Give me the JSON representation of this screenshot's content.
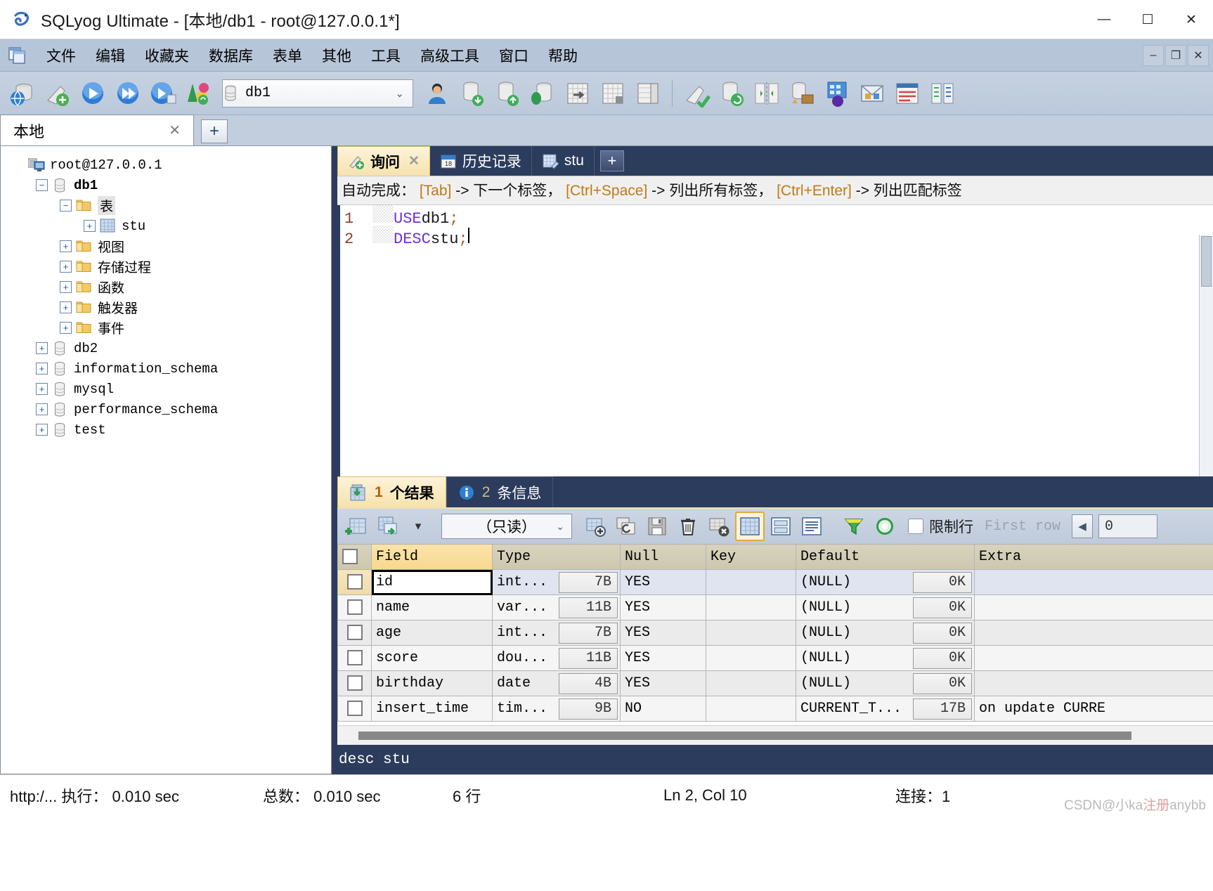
{
  "window": {
    "title": "SQLyog Ultimate - [本地/db1 - root@127.0.0.1*]",
    "minimize": "—",
    "maximize": "☐",
    "close": "✕"
  },
  "menubar": {
    "items": [
      {
        "label": "文件"
      },
      {
        "label": "编辑"
      },
      {
        "label": "收藏夹"
      },
      {
        "label": "数据库"
      },
      {
        "label": "表单"
      },
      {
        "label": "其他"
      },
      {
        "label": "工具"
      },
      {
        "label": "高级工具"
      },
      {
        "label": "窗口"
      },
      {
        "label": "帮助"
      }
    ],
    "mdi": {
      "minimize": "–",
      "restore": "❐",
      "close": "✕"
    }
  },
  "toolbar": {
    "db_selector_value": "db1",
    "db_selector_caret": "⌄",
    "icons": [
      "new-connection-icon",
      "new-query-icon",
      "execute-query-icon",
      "execute-all-icon",
      "execute-current-icon",
      "schema-sync-icon"
    ],
    "icons_right": [
      "user-manager-icon",
      "import-db-icon",
      "export-db-icon",
      "backup-db-icon",
      "export-grid-icon",
      "table-data-icon",
      "table-diagnostics-icon",
      "query-builder-icon",
      "sync-db-icon",
      "schema-compare-icon",
      "data-transfer-icon",
      "scheduled-backup-icon",
      "notification-services-icon",
      "form-view-icon",
      "sql-formatter-icon"
    ]
  },
  "connection_tabs": {
    "items": [
      {
        "label": "本地",
        "close": "✕"
      }
    ],
    "add_label": "+"
  },
  "tree": {
    "nodes": [
      {
        "expander": "",
        "icon": "host-icon",
        "label": "root@127.0.0.1",
        "indent": 0,
        "bold": false,
        "selected": "none"
      },
      {
        "expander": "−",
        "icon": "database-icon",
        "label": "db1",
        "indent": 1,
        "bold": true,
        "selected": "none"
      },
      {
        "expander": "−",
        "icon": "folder-icon",
        "label": "表",
        "indent": 2,
        "bold": false,
        "selected": "gray"
      },
      {
        "expander": "+",
        "icon": "table-icon",
        "label": "stu",
        "indent": 3,
        "bold": false,
        "selected": "none"
      },
      {
        "expander": "+",
        "icon": "folder-icon",
        "label": "视图",
        "indent": 2,
        "bold": false,
        "selected": "none"
      },
      {
        "expander": "+",
        "icon": "folder-icon",
        "label": "存储过程",
        "indent": 2,
        "bold": false,
        "selected": "none"
      },
      {
        "expander": "+",
        "icon": "folder-icon",
        "label": "函数",
        "indent": 2,
        "bold": false,
        "selected": "none"
      },
      {
        "expander": "+",
        "icon": "folder-icon",
        "label": "触发器",
        "indent": 2,
        "bold": false,
        "selected": "none"
      },
      {
        "expander": "+",
        "icon": "folder-icon",
        "label": "事件",
        "indent": 2,
        "bold": false,
        "selected": "none"
      },
      {
        "expander": "+",
        "icon": "database-icon",
        "label": "db2",
        "indent": 1,
        "bold": false,
        "selected": "none"
      },
      {
        "expander": "+",
        "icon": "database-icon",
        "label": "information_schema",
        "indent": 1,
        "bold": false,
        "selected": "none"
      },
      {
        "expander": "+",
        "icon": "database-icon",
        "label": "mysql",
        "indent": 1,
        "bold": false,
        "selected": "none"
      },
      {
        "expander": "+",
        "icon": "database-icon",
        "label": "performance_schema",
        "indent": 1,
        "bold": false,
        "selected": "none"
      },
      {
        "expander": "+",
        "icon": "database-icon",
        "label": "test",
        "indent": 1,
        "bold": false,
        "selected": "none"
      }
    ]
  },
  "editor": {
    "tabs": [
      {
        "label": "询问",
        "icon": "query-icon",
        "active": true,
        "close": "✕"
      },
      {
        "label": "历史记录",
        "icon": "calendar-icon",
        "active": false,
        "close": ""
      },
      {
        "label": "stu",
        "icon": "table-edit-icon",
        "active": false,
        "close": ""
      }
    ],
    "add_label": "+",
    "autocomplete": {
      "prefix": "自动完成：",
      "parts": [
        {
          "kbd": "[Tab]",
          "text": "-> 下一个标签，"
        },
        {
          "kbd": "[Ctrl+Space]",
          "text": "-> 列出所有标签，"
        },
        {
          "kbd": "[Ctrl+Enter]",
          "text": "-> 列出匹配标签"
        }
      ]
    },
    "lines": [
      {
        "num": "1",
        "keyword": "USE",
        "ident": " db1",
        "punct": ";",
        "caret": false
      },
      {
        "num": "2",
        "keyword": "DESC",
        "ident": " stu",
        "punct": ";",
        "caret": true
      }
    ]
  },
  "results": {
    "tabs": [
      {
        "icon": "result-grid-icon",
        "num": "1",
        "label": "个结果",
        "active": true
      },
      {
        "icon": "info-icon",
        "num": "2",
        "label": "条信息",
        "active": false
      }
    ],
    "toolbar": {
      "icons_left": [
        "insert-row-icon",
        "duplicate-row-icon"
      ],
      "dropdown_caret": "▾",
      "readonly_value": "（只读）",
      "readonly_caret": "⌄",
      "icons_mid": [
        "add-field-icon",
        "refresh-row-icon",
        "save-changes-icon",
        "delete-row-icon",
        "discard-changes-icon"
      ],
      "view_icons": [
        "grid-view-icon",
        "form-view-icon",
        "text-view-icon"
      ],
      "icons_right": [
        "filter-icon",
        "refresh-icon"
      ],
      "limit_label": "限制行",
      "first_row_label": "First row",
      "spin_left": "◀",
      "spin_value": "0"
    },
    "grid": {
      "columns": [
        "Field",
        "Type",
        "Null",
        "Key",
        "Default",
        "Extra"
      ],
      "rows": [
        {
          "field": "id",
          "type": "int...",
          "size": "7B",
          "null": "YES",
          "key": "",
          "default": "(NULL)",
          "default_size": "0K",
          "extra": ""
        },
        {
          "field": "name",
          "type": "var...",
          "size": "11B",
          "null": "YES",
          "key": "",
          "default": "(NULL)",
          "default_size": "0K",
          "extra": ""
        },
        {
          "field": "age",
          "type": "int...",
          "size": "7B",
          "null": "YES",
          "key": "",
          "default": "(NULL)",
          "default_size": "0K",
          "extra": ""
        },
        {
          "field": "score",
          "type": "dou...",
          "size": "11B",
          "null": "YES",
          "key": "",
          "default": "(NULL)",
          "default_size": "0K",
          "extra": ""
        },
        {
          "field": "birthday",
          "type": "date",
          "size": "4B",
          "null": "YES",
          "key": "",
          "default": "(NULL)",
          "default_size": "0K",
          "extra": ""
        },
        {
          "field": "insert_time",
          "type": "tim...",
          "size": "9B",
          "null": "NO",
          "key": "",
          "default": "CURRENT_T...",
          "default_size": "17B",
          "extra": "on update CURRE"
        }
      ]
    },
    "sql_echo": "desc stu"
  },
  "statusbar": {
    "exec": "http:/... 执行：  0.010 sec",
    "total": "总数：  0.010 sec",
    "rows": "6 行",
    "position": "Ln 2, Col 10",
    "connections": "连接：1",
    "watermark_prefix": "CSD",
    "watermark_mid": "N@小ka",
    "watermark_reg": "注册",
    "watermark_suffix": "any",
    "watermark_tail": "bb"
  },
  "colors": {
    "accent_tab": "#f6e2ae",
    "panel_dark": "#2c3c5c",
    "chrome": "#b7c5d8",
    "header_field": "#f6d98f"
  }
}
